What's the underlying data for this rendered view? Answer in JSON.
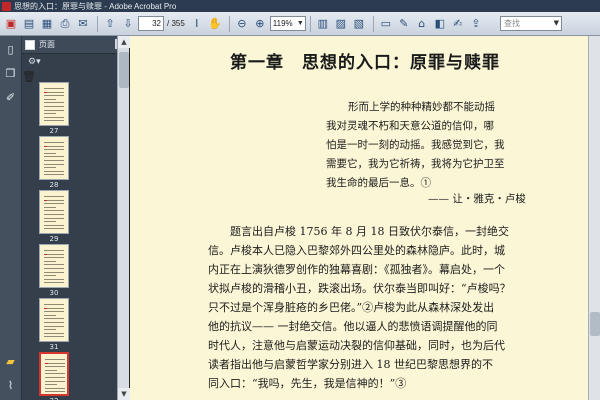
{
  "window": {
    "title": "思想的入口：原罪与赎罪 - Adobe Acrobat Pro"
  },
  "toolbar": {
    "page_current": "32",
    "page_total": "/ 355",
    "zoom": "119%",
    "search_placeholder": "查找"
  },
  "sidebar": {
    "panel_label": "页面",
    "thumbnails": [
      {
        "label": "27"
      },
      {
        "label": "28"
      },
      {
        "label": "29"
      },
      {
        "label": "30"
      },
      {
        "label": "31"
      },
      {
        "label": "32"
      }
    ]
  },
  "document": {
    "chapter_title": "第一章　思想的入口：原罪与赎罪",
    "epigraph": [
      "形而上学的种种精妙都不能动摇",
      "我对灵魂不朽和天意公道的信仰，哪",
      "怕是一时一刻的动摇。我感觉到它，我",
      "需要它，我为它祈祷，我将为它护卫至",
      "我生命的最后一息。①"
    ],
    "attribution": "—— 让・雅克・卢梭",
    "body": [
      "题言出自卢梭 1756 年 8 月 18 日致伏尔泰信，一封绝交",
      "信。卢梭本人已隐入巴黎郊外四公里处的森林隐庐。此时，城",
      "内正在上演狄德罗创作的独幕喜剧：《孤独者》。幕启处，一个",
      "状拟卢梭的滑稽小丑，跌滚出场。伏尔泰当即叫好：“卢梭吗？",
      "只不过是个浑身脏疮的乡巴佬。”②卢梭为此从森林深处发出",
      "他的抗议—— 一封绝交信。他以逼人的悲愤语调提醒他的同",
      "时代人，注意他与启蒙运动决裂的信仰基础，同时，也为后代",
      "读者指出他与启蒙哲学家分别进入 18 世纪巴黎思想界的不",
      "同入口：“我吗，先生，我是信神的！”③"
    ]
  }
}
